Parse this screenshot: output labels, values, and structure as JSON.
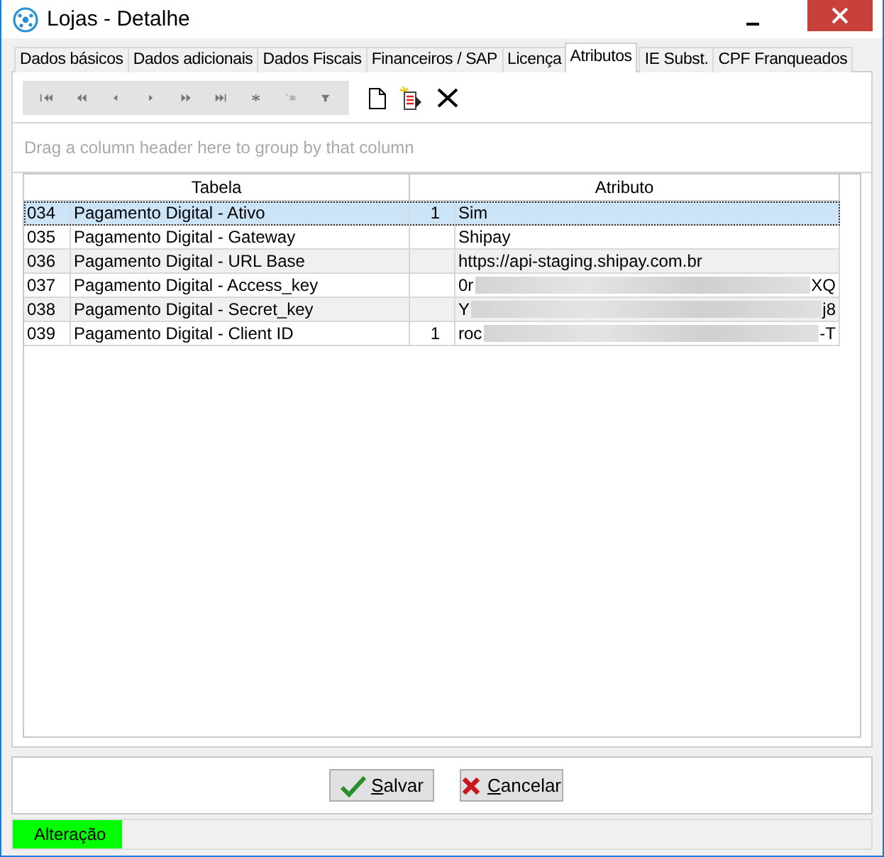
{
  "window": {
    "title": "Lojas - Detalhe"
  },
  "tabs": [
    {
      "label": "Dados básicos",
      "selected": false
    },
    {
      "label": "Dados adicionais",
      "selected": false
    },
    {
      "label": "Dados Fiscais",
      "selected": false
    },
    {
      "label": "Financeiros / SAP",
      "selected": false
    },
    {
      "label": "Licença",
      "selected": false
    },
    {
      "label": "Atributos",
      "selected": true
    },
    {
      "label": "IE Subst.",
      "selected": false
    },
    {
      "label": "CPF Franqueados",
      "selected": false
    }
  ],
  "group_panel": {
    "placeholder": "Drag a column header here to group by that column"
  },
  "table": {
    "columns": [
      "Tabela",
      "Atributo"
    ],
    "rows": [
      {
        "code": "034",
        "name": "Pagamento Digital - Ativo",
        "flag": "1",
        "value": "Sim",
        "redacted": false,
        "selected": true
      },
      {
        "code": "035",
        "name": "Pagamento Digital - Gateway",
        "flag": "",
        "value": "Shipay",
        "redacted": false,
        "selected": false
      },
      {
        "code": "036",
        "name": "Pagamento Digital - URL Base",
        "flag": "",
        "value": "https://api-staging.shipay.com.br",
        "redacted": false,
        "selected": false
      },
      {
        "code": "037",
        "name": "Pagamento Digital - Access_key",
        "flag": "",
        "value": "0r",
        "value_end": "XQ",
        "redacted": true,
        "selected": false
      },
      {
        "code": "038",
        "name": "Pagamento Digital - Secret_key",
        "flag": "",
        "value": "Y",
        "value_end": "j8",
        "redacted": true,
        "selected": false
      },
      {
        "code": "039",
        "name": "Pagamento Digital - Client ID",
        "flag": "1",
        "value": "roc",
        "value_end": "-T",
        "redacted": true,
        "selected": false
      }
    ]
  },
  "buttons": [
    {
      "kind": "save",
      "label": "Salvar"
    },
    {
      "kind": "cancel",
      "label": "Cancelar"
    }
  ],
  "status_bar": {
    "mode": "Alteração"
  }
}
